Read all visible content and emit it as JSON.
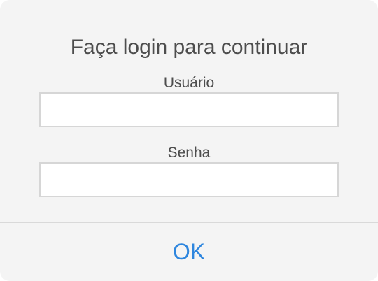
{
  "dialog": {
    "title": "Faça login para continuar",
    "username": {
      "label": "Usuário",
      "value": "",
      "placeholder": ""
    },
    "password": {
      "label": "Senha",
      "value": "",
      "placeholder": ""
    },
    "ok_label": "OK"
  },
  "colors": {
    "dialog_background": "#f4f4f4",
    "text": "#4d4d4d",
    "field_border": "#d6d6d6",
    "divider": "#d9d9d9",
    "accent": "#2e86de"
  }
}
